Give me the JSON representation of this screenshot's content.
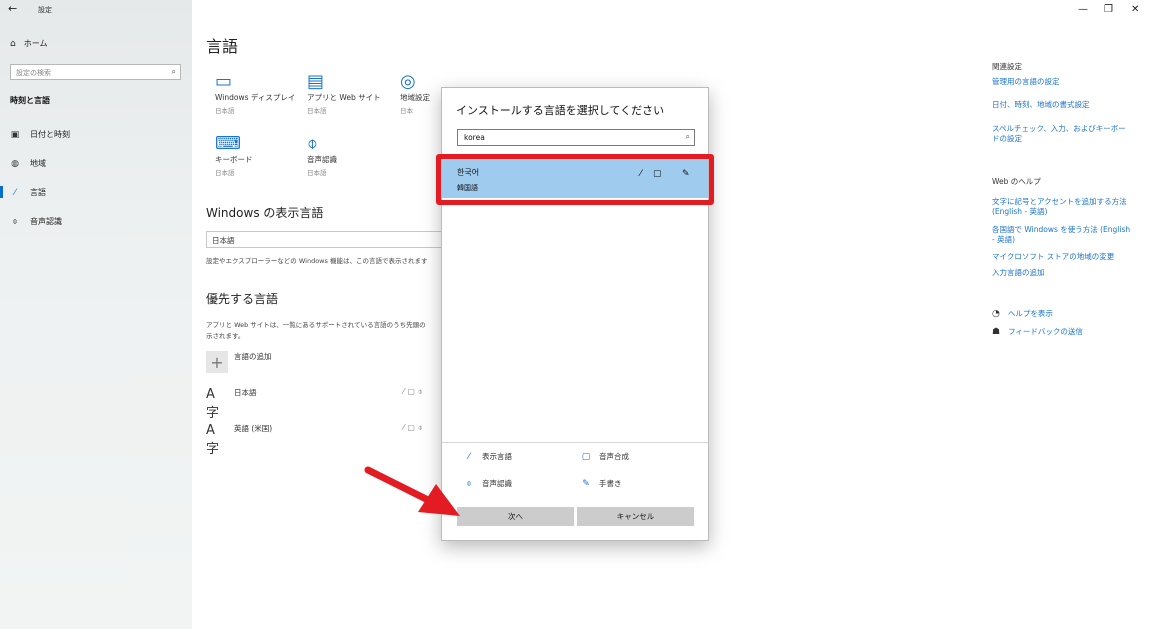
{
  "window": {
    "title": "設定",
    "back_icon": "←",
    "minimize": "—",
    "restore": "❐",
    "close": "✕"
  },
  "sidebar": {
    "home_label": "ホーム",
    "search_placeholder": "設定の検索",
    "section_title": "時刻と言語",
    "items": [
      {
        "label": "日付と時刻",
        "icon": "calendar-icon"
      },
      {
        "label": "地域",
        "icon": "globe-icon"
      },
      {
        "label": "言語",
        "icon": "language-icon"
      },
      {
        "label": "音声認識",
        "icon": "microphone-icon"
      }
    ]
  },
  "main": {
    "title": "言語",
    "tiles": [
      {
        "label": "Windows ディスプレイ",
        "sub": "日本語"
      },
      {
        "label": "アプリと Web サイト",
        "sub": "日本語"
      },
      {
        "label": "地域設定",
        "sub": "日本"
      },
      {
        "label": "キーボード",
        "sub": "日本語"
      },
      {
        "label": "音声認識",
        "sub": "日本語"
      }
    ],
    "display_lang_heading": "Windows の表示言語",
    "display_lang_value": "日本語",
    "display_lang_desc": "設定やエクスプローラーなどの Windows 機能は、この言語で表示されます",
    "preferred_heading": "優先する言語",
    "preferred_desc_1": "アプリと Web サイトは、一覧にあるサポートされている言語のうち先頭の",
    "preferred_desc_2": "示されます。",
    "add_lang_label": "言語の追加",
    "languages": [
      {
        "name": "日本語"
      },
      {
        "name": "英語 (米国)"
      }
    ]
  },
  "right": {
    "related_heading": "関連設定",
    "related_links": [
      "管理用の言語の設定",
      "日付、時刻、地域の書式設定",
      "スペルチェック、入力、およびキーボードの設定"
    ],
    "help_heading": "Web のヘルプ",
    "help_links": [
      "文字に記号とアクセントを追加する方法 (English - 英語)",
      "各国語で Windows を使う方法 (English - 英語)",
      "マイクロソフト ストアの地域の変更",
      "入力言語の追加"
    ],
    "get_help": "ヘルプを表示",
    "feedback": "フィードバックの送信"
  },
  "dialog": {
    "title": "インストールする言語を選択してください",
    "search_value": "korea",
    "result": {
      "name": "한국어",
      "sub": "韓国語"
    },
    "legend": {
      "display": "表示言語",
      "tts": "音声合成",
      "speech": "音声認識",
      "handwriting": "手書き"
    },
    "next_button": "次へ",
    "cancel_button": "キャンセル"
  },
  "colors": {
    "accent": "#1a73d0",
    "selection": "#9fcbee",
    "highlight_box": "#e31c23",
    "arrow": "#e31c23"
  }
}
